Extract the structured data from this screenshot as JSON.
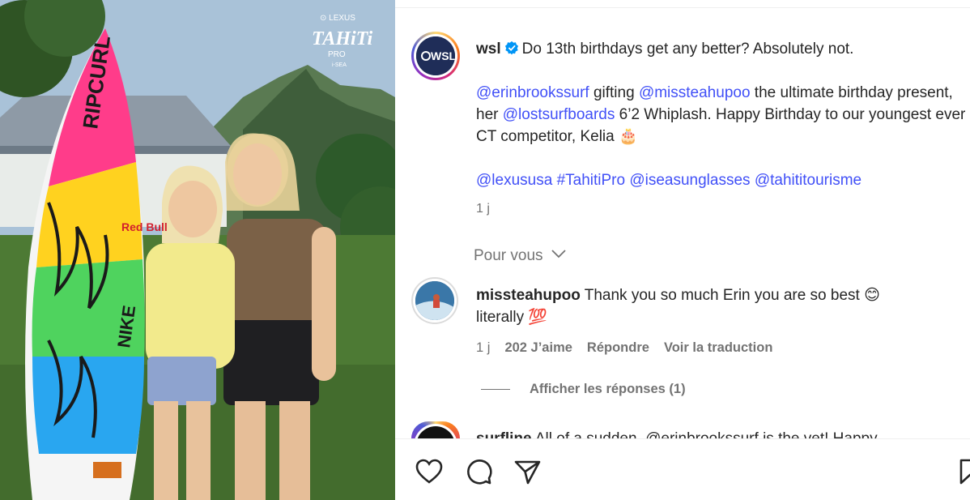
{
  "post": {
    "image_alt": "Two girls standing next to a Rip Curl surfboard in front of mountains",
    "photo_logo": {
      "brand": "LEXUS",
      "event": "TAHITI",
      "sub": "PRO",
      "sponsor": "i-SEA"
    },
    "author": "wsl",
    "caption_line1": "Do 13th birthdays get any better? Absolutely not.",
    "caption_mention1": "@erinbrookssurf",
    "caption_text1": " gifting ",
    "caption_mention2": "@missteahupoo",
    "caption_text2": " the ultimate birthday present, her ",
    "caption_mention3": "@lostsurfboards",
    "caption_text3": " 6’2 Whiplash. Happy Birthday to our youngest ever CT competitor, Kelia ",
    "caption_emoji": "🎂",
    "tags": [
      "@lexususa",
      "#TahitiPro",
      "@iseasunglasses",
      "@tahititourisme"
    ],
    "time": "1 j"
  },
  "section_label": "Pour vous",
  "comment": {
    "user": "missteahupoo",
    "text": "Thank you so much Erin you are so best 😊 literally 💯",
    "time": "1 j",
    "likes": "202 J’aime",
    "reply": "Répondre",
    "translate": "Voir la traduction",
    "show_replies": "Afficher les réponses (1)"
  },
  "next_comment": {
    "user": "surfline",
    "text": "All of a sudden, @erinbrookssurf is the vet! Happy"
  },
  "colors": {
    "link": "#4150f7",
    "verified": "#0095f6",
    "muted": "#737373"
  }
}
